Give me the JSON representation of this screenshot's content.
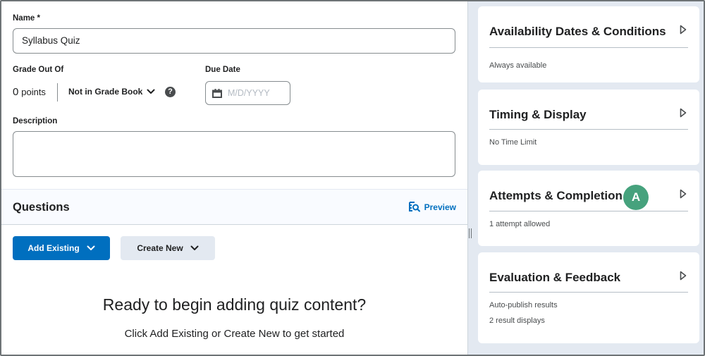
{
  "form": {
    "name_label": "Name *",
    "name_value": "Syllabus Quiz",
    "grade_label": "Grade Out Of",
    "grade_value": "0",
    "grade_unit": "points",
    "gradebook_label": "Not in Grade Book",
    "help_glyph": "?",
    "due_date_label": "Due Date",
    "due_date_placeholder": "M/D/YYYY",
    "description_label": "Description",
    "description_value": ""
  },
  "questions": {
    "title": "Questions",
    "preview_label": "Preview",
    "add_existing_label": "Add Existing",
    "create_new_label": "Create New",
    "empty_title": "Ready to begin adding quiz content?",
    "empty_subtitle": "Click Add Existing or Create New to get started"
  },
  "sidebar": {
    "cards": [
      {
        "title": "Availability Dates & Conditions",
        "lines": [
          "Always available"
        ]
      },
      {
        "title": "Timing & Display",
        "lines": [
          "No Time Limit"
        ]
      },
      {
        "title": "Attempts & Completion",
        "lines": [
          "1 attempt allowed"
        ],
        "avatar": "A"
      },
      {
        "title": "Evaluation & Feedback",
        "lines": [
          "Auto-publish results",
          "2 result displays"
        ]
      }
    ]
  },
  "colors": {
    "primary": "#006fbf",
    "secondary_button": "#e3e9f1",
    "sidebar_bg": "#e3e9f1",
    "avatar": "#46a27d"
  }
}
